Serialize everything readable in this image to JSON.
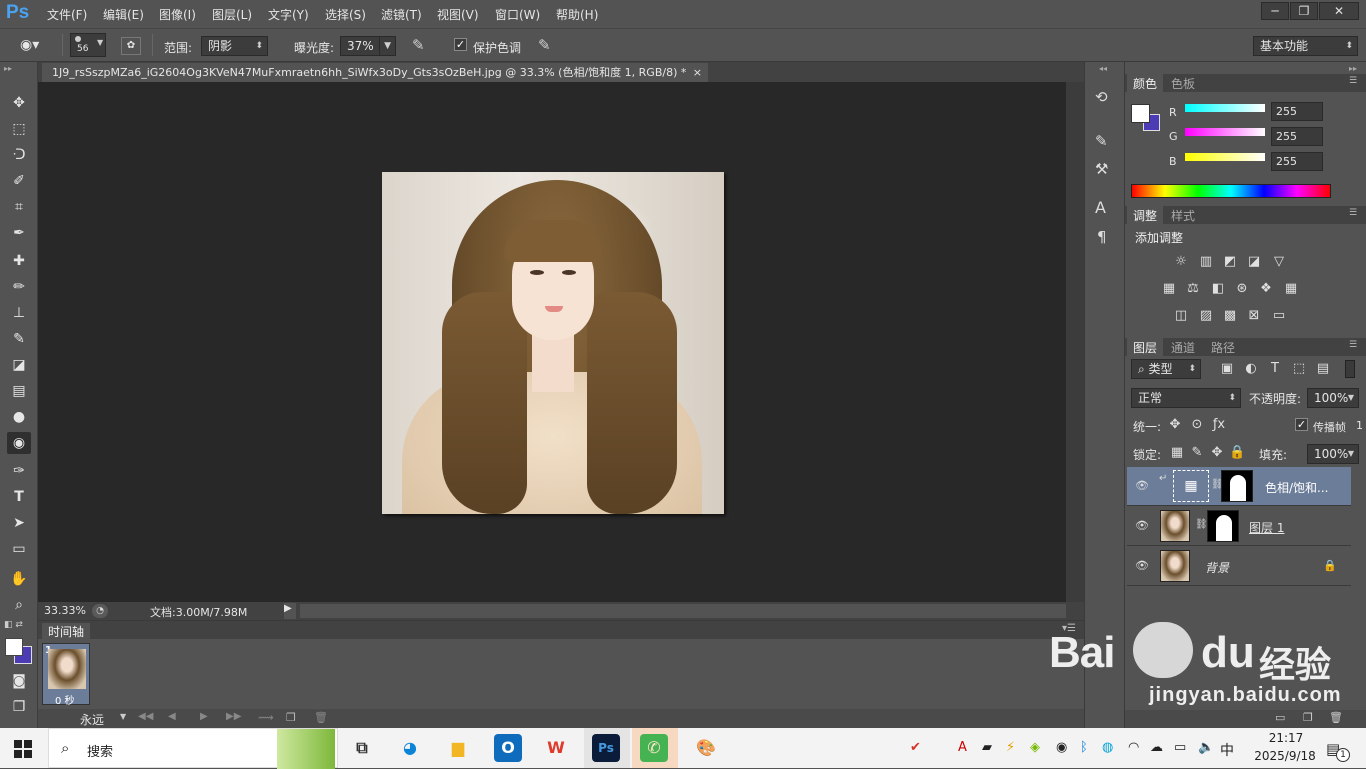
{
  "app": {
    "logo": "Ps",
    "menu": [
      "文件(F)",
      "编辑(E)",
      "图像(I)",
      "图层(L)",
      "文字(Y)",
      "选择(S)",
      "滤镜(T)",
      "视图(V)",
      "窗口(W)",
      "帮助(H)"
    ],
    "window_controls": [
      "─",
      "❐",
      "✕"
    ]
  },
  "options": {
    "brush_size": "56",
    "range_label": "范围:",
    "range_value": "阴影",
    "exposure_label": "曝光度:",
    "exposure_value": "37%",
    "protect_tones_label": "保护色调",
    "protect_tones_checked": true,
    "workspace": "基本功能"
  },
  "document": {
    "tab_title": "1J9_rsSszpMZa6_iG2604Og3KVeN47MuFxmraetn6hh_SiWfx3oDy_Gts3sOzBeH.jpg @ 33.3% (色相/饱和度 1, RGB/8) *",
    "tab_close": "×",
    "zoom": "33.33%",
    "doc_size": "文档:3.00M/7.98M"
  },
  "timeline": {
    "title": "时间轴",
    "frame_number": "1",
    "frame_delay": "0 秒",
    "loop": "永远"
  },
  "color_panel": {
    "tabs": [
      "颜色",
      "色板"
    ],
    "channels": [
      {
        "label": "R",
        "value": "255",
        "gradient": "#00ffff"
      },
      {
        "label": "G",
        "value": "255",
        "gradient": "#ff00ff"
      },
      {
        "label": "B",
        "value": "255",
        "gradient": "#ffff00"
      }
    ],
    "foreground": "#ffffff",
    "background": "#4b3bb5"
  },
  "adjustments_panel": {
    "tabs": [
      "调整",
      "样式"
    ],
    "title": "添加调整"
  },
  "layers_panel": {
    "tabs": [
      "图层",
      "通道",
      "路径"
    ],
    "filter_kind": "类型",
    "blend_mode": "正常",
    "opacity_label": "不透明度:",
    "opacity_value": "100%",
    "unify_label": "统一:",
    "propagate_label": "传播帧",
    "propagate_value": "1",
    "lock_label": "锁定:",
    "fill_label": "填充:",
    "fill_value": "100%",
    "layers": [
      {
        "name": "色相/饱和...",
        "type": "adjustment",
        "selected": true
      },
      {
        "name": "图层 1",
        "type": "pixel",
        "selected": false
      },
      {
        "name": "背景",
        "type": "background",
        "selected": false
      }
    ]
  },
  "taskbar": {
    "search_placeholder": "搜索",
    "time": "21:17",
    "date": "2025/9/18",
    "ime": "中",
    "notification_count": "1"
  },
  "watermark": {
    "brand": "Bai",
    "brand2": "du",
    "suffix": "经验",
    "url": "jingyan.baidu.com"
  }
}
